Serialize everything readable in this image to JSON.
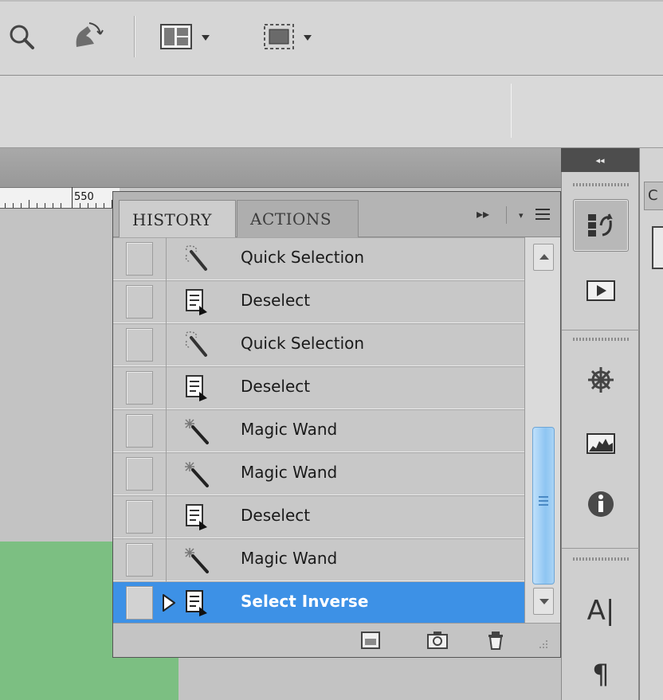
{
  "ruler": {
    "label": "550"
  },
  "dock": {
    "collapse_glyph": "◂◂"
  },
  "far_right_tab_label": "C",
  "history_panel": {
    "tabs": [
      {
        "label": "HISTORY",
        "active": true
      },
      {
        "label": "ACTIONS",
        "active": false
      }
    ],
    "forward_glyph": "▸▸",
    "items": [
      {
        "label": "Quick Selection",
        "icon": "quick-selection-icon"
      },
      {
        "label": "Deselect",
        "icon": "deselect-icon"
      },
      {
        "label": "Quick Selection",
        "icon": "quick-selection-icon"
      },
      {
        "label": "Deselect",
        "icon": "deselect-icon"
      },
      {
        "label": "Magic Wand",
        "icon": "magic-wand-icon"
      },
      {
        "label": "Magic Wand",
        "icon": "magic-wand-icon"
      },
      {
        "label": "Deselect",
        "icon": "deselect-icon"
      },
      {
        "label": "Magic Wand",
        "icon": "magic-wand-icon"
      },
      {
        "label": "Select Inverse",
        "icon": "select-inverse-icon",
        "selected": true
      }
    ]
  },
  "colors": {
    "selection": "#3d91e6",
    "canvas_green": "#7cbf82",
    "scroll_thumb": "#8ec5f2"
  }
}
